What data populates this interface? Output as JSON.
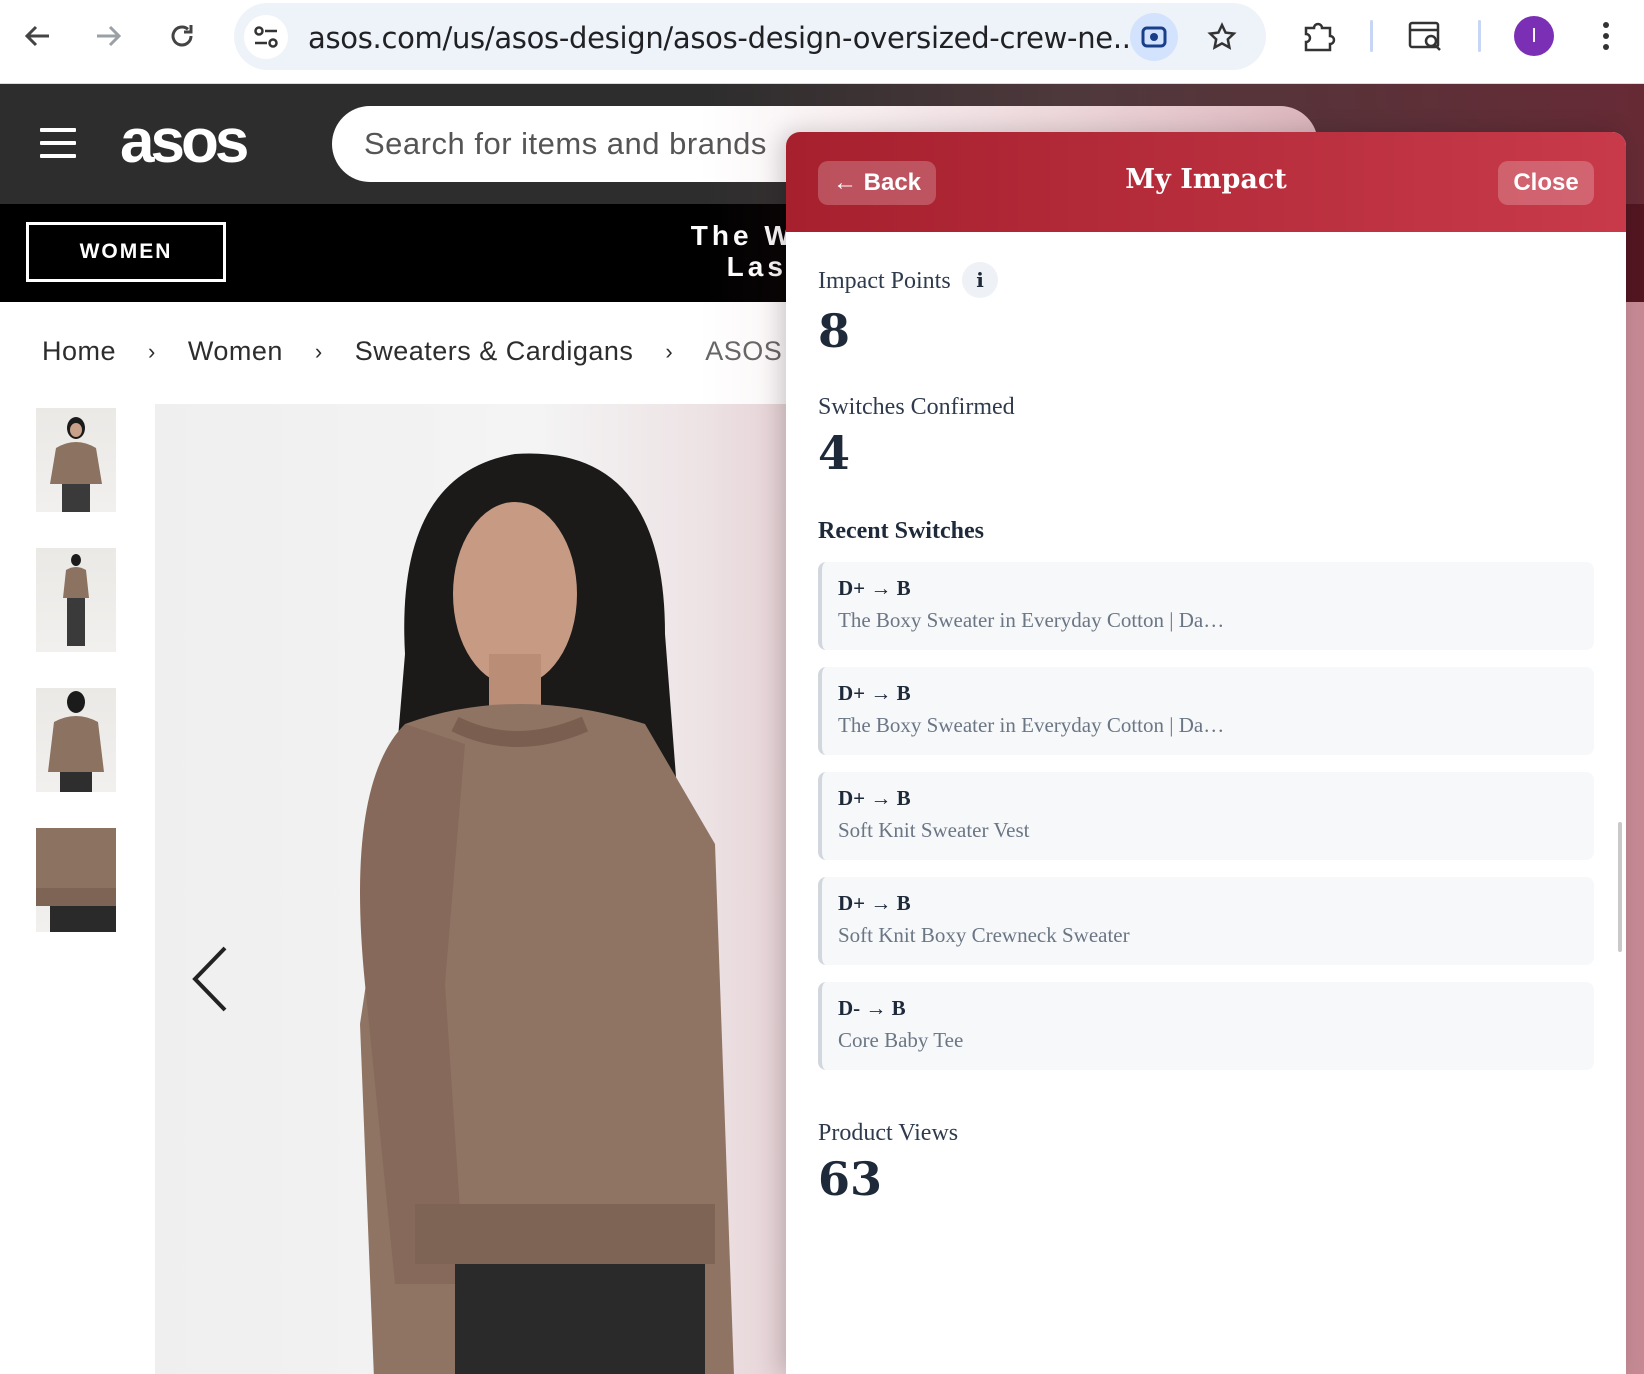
{
  "browser": {
    "url": "asos.com/us/asos-design/asos-design-oversized-crew-ne...",
    "profile_initial": "I"
  },
  "site": {
    "logo": "asos",
    "search_placeholder": "Search for items and brands",
    "women_label": "WOMEN",
    "promo_line1": "The Winter Sa",
    "promo_line2": "Last chan"
  },
  "breadcrumb": {
    "items": [
      "Home",
      "Women",
      "Sweaters & Cardigans"
    ],
    "current": "ASOS DE",
    "separator": "›"
  },
  "panel": {
    "back_label": "← Back",
    "title": "My Impact",
    "close_label": "Close",
    "impact_points_label": "Impact Points",
    "info_icon": "i",
    "impact_points_value": "8",
    "switches_label": "Switches Confirmed",
    "switches_value": "4",
    "recent_title": "Recent Switches",
    "recent": [
      {
        "grade": "D+ → B",
        "name": "The Boxy Sweater in Everyday Cotton | Da…"
      },
      {
        "grade": "D+ → B",
        "name": "The Boxy Sweater in Everyday Cotton | Da…"
      },
      {
        "grade": "D+ → B",
        "name": "Soft Knit Sweater Vest"
      },
      {
        "grade": "D+ → B",
        "name": "Soft Knit Boxy Crewneck Sweater"
      },
      {
        "grade": "D- → B",
        "name": "Core Baby Tee"
      }
    ],
    "views_label": "Product Views",
    "views_value": "63"
  },
  "colors": {
    "panel_header_start": "#a6202e",
    "panel_header_end": "#c83a4a",
    "asos_dark": "#2d2d2d",
    "avatar": "#7b2fb5"
  }
}
